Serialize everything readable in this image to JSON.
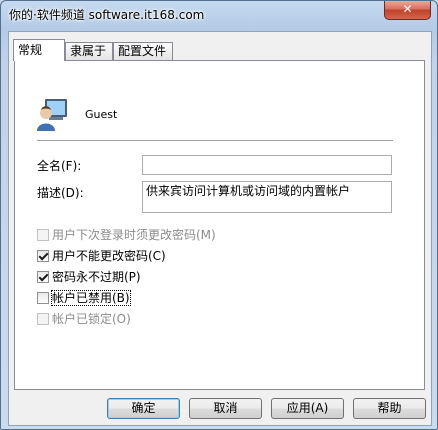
{
  "window": {
    "title": "你的·软件频道 software.it168.com",
    "close_symbol": "✕"
  },
  "tabs": [
    {
      "label": "常规",
      "active": true
    },
    {
      "label": "隶属于",
      "active": false
    },
    {
      "label": "配置文件",
      "active": false
    }
  ],
  "user": {
    "icon": "user-account-icon",
    "name": "Guest"
  },
  "fields": {
    "full_name": {
      "label": "全名(F):",
      "value": ""
    },
    "description": {
      "label": "描述(D):",
      "value": "供来宾访问计算机或访问域的内置帐户"
    }
  },
  "options": [
    {
      "label": "用户下次登录时须更改密码(M)",
      "checked": false,
      "enabled": false
    },
    {
      "label": "用户不能更改密码(C)",
      "checked": true,
      "enabled": true
    },
    {
      "label": "密码永不过期(P)",
      "checked": true,
      "enabled": true
    },
    {
      "label": "帐户已禁用(B)",
      "checked": false,
      "enabled": true
    },
    {
      "label": "帐户已锁定(O)",
      "checked": false,
      "enabled": false
    }
  ],
  "buttons": {
    "ok": "确定",
    "cancel": "取消",
    "apply": "应用(A)",
    "help": "帮助"
  }
}
